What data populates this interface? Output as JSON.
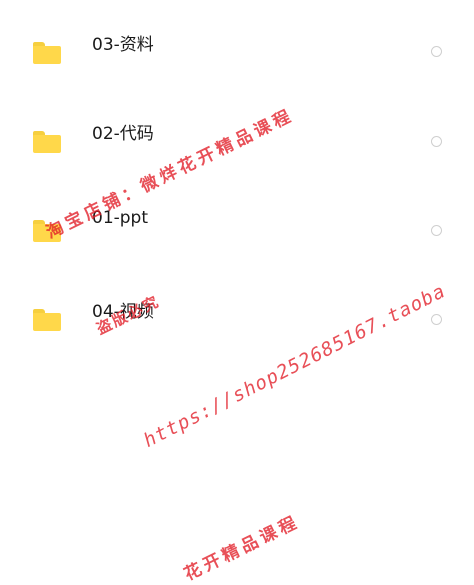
{
  "files": [
    {
      "name": "03-资料",
      "type_icon": "folder-icon",
      "selected": false
    },
    {
      "name": "02-代码",
      "type_icon": "folder-icon",
      "selected": false
    },
    {
      "name": "01-ppt",
      "type_icon": "folder-icon",
      "selected": false
    },
    {
      "name": "04-视频",
      "type_icon": "folder-icon",
      "selected": false
    }
  ],
  "watermarks": {
    "shop": "淘宝店铺：微烊花开精品课程",
    "notice": "盗版必究",
    "url": "https://shop252685167.taoba",
    "shop_repeat": "花开精品课程"
  },
  "colors": {
    "folder": "#ffd84a",
    "folder_tab": "#f6cf3f",
    "watermark": "#e11e28",
    "radio_border": "#cfcfcf"
  }
}
